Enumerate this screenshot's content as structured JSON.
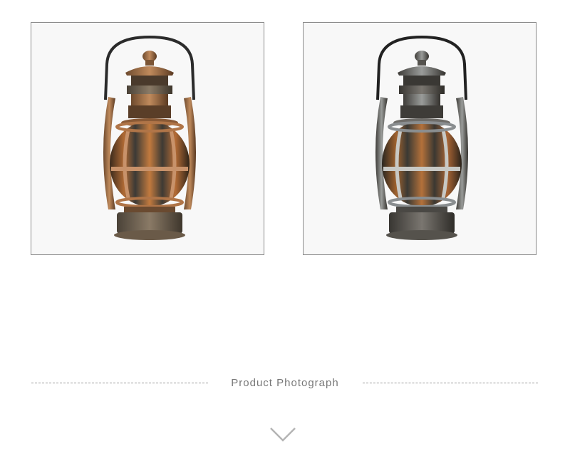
{
  "images": [
    {
      "name": "lantern-copper-photo",
      "finish": "copper",
      "metal_color": "#b07548",
      "dark_color": "#5a3820",
      "handle_color": "#2b2b2b",
      "base_color": "#5c5448"
    },
    {
      "name": "lantern-silver-photo",
      "finish": "silver",
      "metal_color": "#8a8e90",
      "dark_color": "#3e3c38",
      "handle_color": "#222222",
      "base_color": "#4a4844"
    }
  ],
  "section": {
    "title": "Product Photograph"
  },
  "icons": {
    "scroll_down": "chevron-down-icon"
  }
}
